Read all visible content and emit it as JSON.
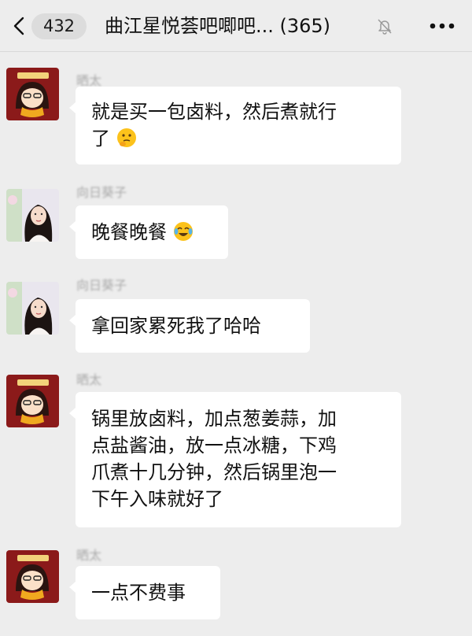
{
  "header": {
    "back_icon": "chevron-left-icon",
    "unread_count": "432",
    "title": "曲江星悦荟吧唧吧... (365)",
    "mute_icon": "bell-slash-icon",
    "more_icon": "ellipsis-icon"
  },
  "messages": [
    {
      "sender": "晒太",
      "avatar": "cartoon-girl-avatar",
      "lines": [
        "就是买一包卤料，然后煮就行",
        "了"
      ],
      "emoji": "thinking-face-emoji"
    },
    {
      "sender": "向日葵子",
      "avatar": "woman-photo-avatar",
      "lines": [
        "晚餐晚餐"
      ],
      "emoji": "tears-of-joy-emoji"
    },
    {
      "sender": "向日葵子",
      "avatar": "woman-photo-avatar",
      "lines": [
        "拿回家累死我了哈哈"
      ]
    },
    {
      "sender": "晒太",
      "avatar": "cartoon-girl-avatar",
      "lines": [
        "锅里放卤料，加点葱姜蒜，加",
        "点盐酱油，放一点冰糖，下鸡",
        "爪煮十几分钟，然后锅里泡一",
        "下午入味就好了"
      ]
    },
    {
      "sender": "晒太",
      "avatar": "cartoon-girl-avatar",
      "lines": [
        "一点不费事"
      ]
    }
  ],
  "colors": {
    "background": "#ededed",
    "bubble": "#ffffff",
    "avatar_red": "#8b1a1a"
  }
}
